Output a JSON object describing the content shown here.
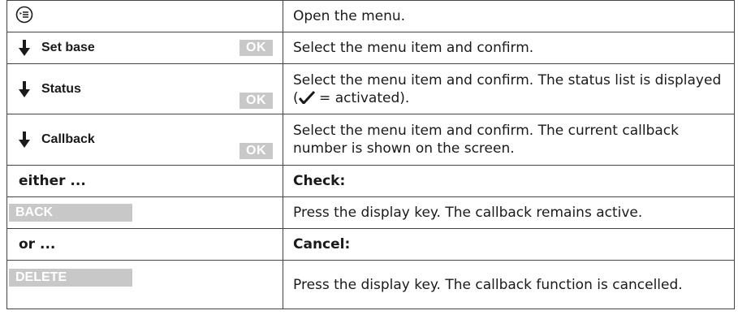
{
  "rows": [
    {
      "description": "Open the menu."
    },
    {
      "item": "Set base",
      "button": "OK",
      "description": "Select the menu item and confirm."
    },
    {
      "item": "Status",
      "button": "OK",
      "description_before": "Select the menu item and confirm. The status list is displayed (",
      "description_after": " = activated)."
    },
    {
      "item": "Callback",
      "button": "OK",
      "description": "Select the menu item and confirm. The current callback number is shown on the screen."
    },
    {
      "left": "either ...",
      "description": "Check:"
    },
    {
      "key": "BACK",
      "description": "Press the display key. The callback remains active."
    },
    {
      "left": "or ...",
      "description": "Cancel:"
    },
    {
      "key": "DELETE",
      "description": "Press the display key. The callback function is cancelled."
    }
  ],
  "icons": {
    "menu": "menu-key-icon",
    "down": "down-arrow-icon",
    "check": "checkmark-icon"
  },
  "colors": {
    "key_bg": "#c8c8c8",
    "key_text": "#ffffff",
    "border": "#444444"
  }
}
